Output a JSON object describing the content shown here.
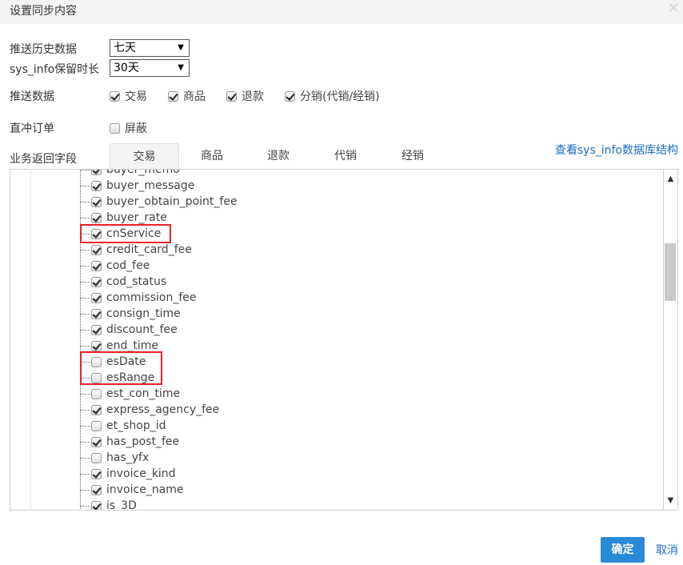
{
  "dialog": {
    "title": "设置同步内容",
    "close_icon": "close-icon"
  },
  "history": {
    "label": "推送历史数据",
    "value": "七天"
  },
  "retention": {
    "label": "sys_info保留时长",
    "value": "30天"
  },
  "push": {
    "label": "推送数据",
    "items": [
      {
        "label": "交易",
        "checked": true
      },
      {
        "label": "商品",
        "checked": true
      },
      {
        "label": "退款",
        "checked": true
      },
      {
        "label": "分销(代销/经销)",
        "checked": true
      }
    ]
  },
  "direct_order": {
    "label": "直冲订单",
    "option_label": "屏蔽",
    "checked": false
  },
  "return_fields": {
    "label": "业务返回字段"
  },
  "tabs": [
    {
      "label": "交易",
      "active": true
    },
    {
      "label": "商品",
      "active": false
    },
    {
      "label": "退款",
      "active": false
    },
    {
      "label": "代销",
      "active": false
    },
    {
      "label": "经销",
      "active": false
    }
  ],
  "schema_link": "查看sys_info数据库结构",
  "fields": [
    {
      "name": "buyer_memo",
      "checked": true
    },
    {
      "name": "buyer_message",
      "checked": true
    },
    {
      "name": "buyer_obtain_point_fee",
      "checked": true
    },
    {
      "name": "buyer_rate",
      "checked": true
    },
    {
      "name": "cnService",
      "checked": true
    },
    {
      "name": "credit_card_fee",
      "checked": true
    },
    {
      "name": "cod_fee",
      "checked": true
    },
    {
      "name": "cod_status",
      "checked": true
    },
    {
      "name": "commission_fee",
      "checked": true
    },
    {
      "name": "consign_time",
      "checked": true
    },
    {
      "name": "discount_fee",
      "checked": true
    },
    {
      "name": "end_time",
      "checked": true
    },
    {
      "name": "esDate",
      "checked": false
    },
    {
      "name": "esRange",
      "checked": false
    },
    {
      "name": "est_con_time",
      "checked": false
    },
    {
      "name": "express_agency_fee",
      "checked": true
    },
    {
      "name": "et_shop_id",
      "checked": false
    },
    {
      "name": "has_post_fee",
      "checked": true
    },
    {
      "name": "has_yfx",
      "checked": false
    },
    {
      "name": "invoice_kind",
      "checked": true
    },
    {
      "name": "invoice_name",
      "checked": true
    },
    {
      "name": "is_3D",
      "checked": true
    }
  ],
  "highlight_color": "#e8232a",
  "accent_color": "#2b8ad7",
  "buttons": {
    "ok": "确定",
    "cancel": "取消"
  }
}
